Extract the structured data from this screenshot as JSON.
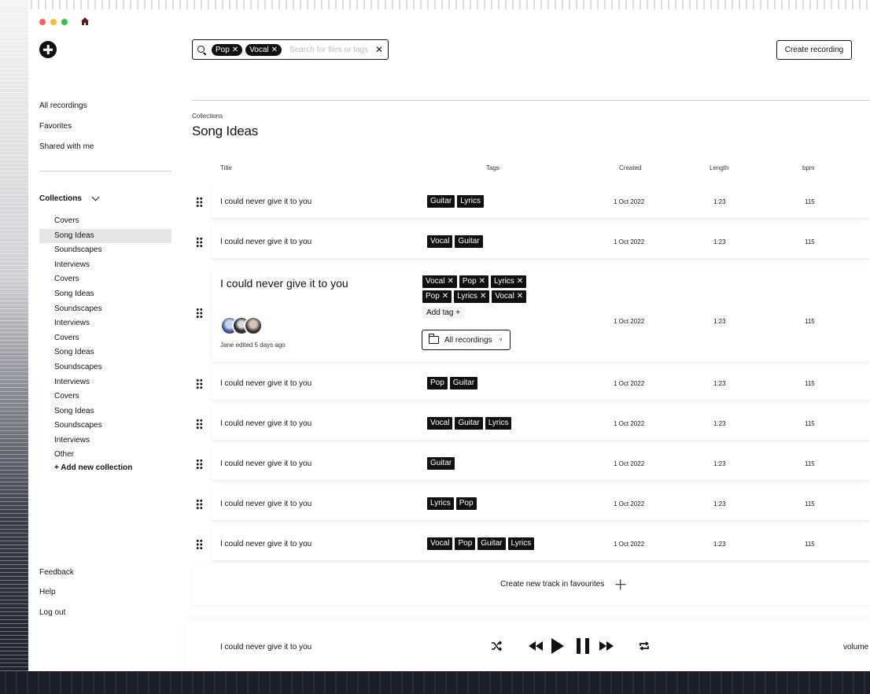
{
  "window": {
    "traffic_lights": [
      "#ff5f57",
      "#febc2e",
      "#28c840"
    ]
  },
  "sidebar": {
    "nav": [
      "All recordings",
      "Favorites",
      "Shared with me"
    ],
    "collections_label": "Collections",
    "collections": [
      "Covers",
      "Song Ideas",
      "Soundscapes",
      "Interviews",
      "Covers",
      "Song Ideas",
      "Soundscapes",
      "Interviews",
      "Covers",
      "Song Ideas",
      "Soundscapes",
      "Interviews",
      "Covers",
      "Song Ideas",
      "Soundscapes",
      "Interviews",
      "Other"
    ],
    "active_collection_index": 1,
    "add_collection": "+ Add new collection",
    "bottom": [
      "Feedback",
      "Help",
      "Log out"
    ]
  },
  "search": {
    "chips": [
      "Pop",
      "Vocal"
    ],
    "placeholder": "Search for files or tags"
  },
  "toolbar": {
    "create_label": "Create recording"
  },
  "page": {
    "breadcrumb": "Collections",
    "title": "Song Ideas"
  },
  "table": {
    "headers": {
      "title": "Title",
      "tags": "Tags",
      "created": "Created",
      "length": "Length",
      "bpm": "bpm"
    },
    "rows": [
      {
        "title": "I could never give it to you",
        "tags": [
          "Guitar",
          "Lyrics"
        ],
        "created": "1 Oct 2022",
        "length": "1:23",
        "bpm": "115"
      },
      {
        "title": "I could never give it to you",
        "tags": [
          "Vocal",
          "Guitar"
        ],
        "created": "1 Oct 2022",
        "length": "1:23",
        "bpm": "115"
      },
      {
        "title": "I could never give it to you",
        "tags": [
          "Vocal",
          "Pop",
          "Lyrics",
          "Pop",
          "Lyrics",
          "Vocal"
        ],
        "created": "1 Oct 2022",
        "length": "1:23",
        "bpm": "115",
        "expanded": true,
        "edited": "Jane edited 5 days ago",
        "add_tag": "Add tag +",
        "folder": "All recordings"
      },
      {
        "title": "I could never give it to you",
        "tags": [
          "Pop",
          "Guitar"
        ],
        "created": "1 Oct 2022",
        "length": "1:23",
        "bpm": "115"
      },
      {
        "title": "I could never give it to you",
        "tags": [
          "Vocal",
          "Guitar",
          "Lyrics"
        ],
        "created": "1 Oct 2022",
        "length": "1:23",
        "bpm": "115"
      },
      {
        "title": "I could never give it to you",
        "tags": [
          "Guitar"
        ],
        "created": "1 Oct 2022",
        "length": "1:23",
        "bpm": "115"
      },
      {
        "title": "I could never give it to you",
        "tags": [
          "Lyrics",
          "Pop"
        ],
        "created": "1 Oct 2022",
        "length": "1:23",
        "bpm": "115"
      },
      {
        "title": "I could never give it to you",
        "tags": [
          "Vocal",
          "Pop",
          "Guitar",
          "Lyrics"
        ],
        "created": "1 Oct 2022",
        "length": "1:23",
        "bpm": "115"
      }
    ],
    "new_track_label": "Create new track in favourites"
  },
  "player": {
    "now_playing": "I could never give it to you",
    "volume_label": "volume",
    "icons": [
      "shuffle-icon",
      "rewind-icon",
      "play-icon",
      "pause-icon",
      "fast-forward-icon",
      "repeat-icon"
    ]
  }
}
